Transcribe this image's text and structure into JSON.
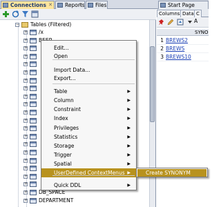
{
  "tabs": [
    {
      "label": "Connections"
    },
    {
      "label": "Reports"
    },
    {
      "label": "Files"
    },
    {
      "label": "Start Page"
    }
  ],
  "tree": {
    "group_label": "Tables (Filtered)",
    "nodes": [
      "/x",
      "BEER",
      "",
      "",
      "",
      "",
      "",
      "",
      "",
      "",
      "",
      "",
      "",
      "",
      "",
      "",
      "",
      "",
      "",
      "",
      "DB_SPACE",
      "DEPARTMENT"
    ]
  },
  "context_menu": {
    "items": [
      {
        "label": "Edit...",
        "submenu": false
      },
      {
        "label": "Open",
        "submenu": false
      },
      {
        "label": "Import Data...",
        "submenu": false
      },
      {
        "label": "Export...",
        "submenu": false
      },
      {
        "label": "Table",
        "submenu": true
      },
      {
        "label": "Column",
        "submenu": true
      },
      {
        "label": "Constraint",
        "submenu": true
      },
      {
        "label": "Index",
        "submenu": true
      },
      {
        "label": "Privileges",
        "submenu": true
      },
      {
        "label": "Statistics",
        "submenu": true
      },
      {
        "label": "Storage",
        "submenu": true
      },
      {
        "label": "Trigger",
        "submenu": true
      },
      {
        "label": "Spatial",
        "submenu": true
      },
      {
        "label": "UserDefined ContextMenus",
        "submenu": true
      },
      {
        "label": "Quick DDL",
        "submenu": true
      }
    ],
    "submenu_item": "Create SYNONYM"
  },
  "right_panel": {
    "subtabs": [
      "Columns",
      "Data",
      "C"
    ],
    "header": "SYNO",
    "rows": [
      {
        "num": "1",
        "value": "BREWS2"
      },
      {
        "num": "2",
        "value": "BREWS"
      },
      {
        "num": "3",
        "value": "BREWS10"
      }
    ]
  },
  "colors": {
    "highlight": "#b8921e",
    "active_tab": "#fde49c",
    "link": "#1a3fb5"
  }
}
